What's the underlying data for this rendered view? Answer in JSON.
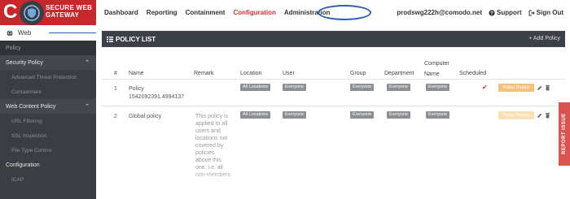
{
  "brand": {
    "letter": "C",
    "line1": "SECURE WEB",
    "line2": "GATEWAY"
  },
  "topnav": {
    "items": [
      "Dashboard",
      "Reporting",
      "Containment",
      "Configuration",
      "Administration"
    ],
    "active": "Configuration",
    "user": "prodswg222h@comodo.net",
    "support": "Support",
    "signout": "Sign Out"
  },
  "sidebar": {
    "web": "Web",
    "section_policy": "Policy",
    "security_policy": "Security Policy",
    "atp": "Advanced Threat Protection",
    "containment": "Containment",
    "web_content_policy": "Web Content Policy",
    "url_filtering": "URL Filtering",
    "ssl_inspection": "SSL Inspection",
    "file_type_control": "File Type Control",
    "configuration": "Configuration",
    "more": "ICAP"
  },
  "panel": {
    "title": "POLICY LIST",
    "add_label": "+ Add Policy"
  },
  "table": {
    "headers": {
      "num": "#",
      "name": "Name",
      "remark": "Remark",
      "location": "Location",
      "user": "User",
      "group": "Group",
      "department": "Department",
      "computer_name_1": "Computer",
      "computer_name_2": "Name",
      "scheduled": "Scheduled"
    },
    "rows": [
      {
        "num": "1",
        "name_1": "Policy",
        "name_2": "1542092391.4994137",
        "location": "All Locations",
        "user": "Everyone",
        "group": "Everyone",
        "department": "Everyone",
        "computer": "Everyone",
        "scheduled": "✔",
        "details": "Policy Details"
      },
      {
        "num": "2",
        "name_1": "Global policy",
        "remark": [
          "This policy is",
          "applied to all",
          "users and",
          "locations not",
          "covered by",
          "policies",
          "above this",
          "one. i.e. all",
          "non-members"
        ],
        "location": "All Locations",
        "user": "Everyone",
        "group": "Everyone",
        "department": "Everyone",
        "computer": "Everyone",
        "details": "Policy Details"
      }
    ]
  },
  "report_tab": "REPORT ISSUE",
  "colors": {
    "accent": "#d32f2f",
    "header_bg": "#3c4047",
    "sidebar_bg": "#3a3d42",
    "details_btn": "#f5c27a",
    "annotation": "#2a5fb8"
  }
}
